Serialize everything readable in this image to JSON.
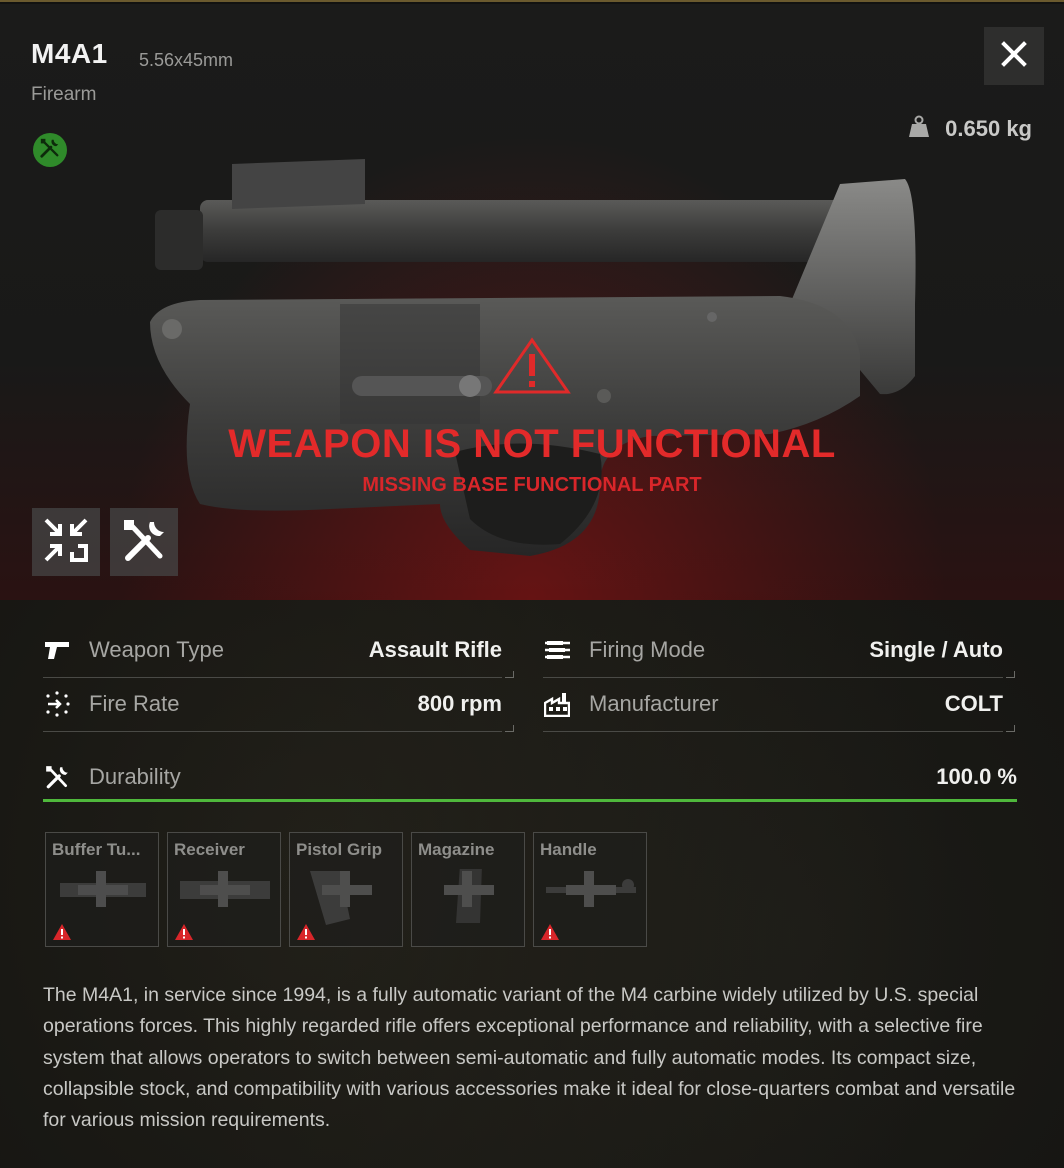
{
  "item": {
    "name": "M4A1",
    "caliber": "5.56x45mm",
    "category": "Firearm",
    "weight": "0.650 kg"
  },
  "status": {
    "title": "WEAPON IS NOT FUNCTIONAL",
    "subtitle": "MISSING BASE FUNCTIONAL PART"
  },
  "stats": {
    "weapon_type_label": "Weapon Type",
    "weapon_type_value": "Assault Rifle",
    "fire_rate_label": "Fire Rate",
    "fire_rate_value": "800 rpm",
    "firing_mode_label": "Firing Mode",
    "firing_mode_value": "Single / Auto",
    "manufacturer_label": "Manufacturer",
    "manufacturer_value": "COLT",
    "durability_label": "Durability",
    "durability_value": "100.0 %",
    "durability_fraction": 1.0
  },
  "slots": [
    {
      "name": "Buffer Tu...",
      "missing": true
    },
    {
      "name": "Receiver",
      "missing": true
    },
    {
      "name": "Pistol Grip",
      "missing": true
    },
    {
      "name": "Magazine",
      "missing": false
    },
    {
      "name": "Handle",
      "missing": true
    }
  ],
  "description": "The M4A1, in service since 1994, is a fully automatic variant of the M4 carbine widely utilized by U.S. special operations forces. This highly regarded rifle offers exceptional performance and reliability, with a selective fire system that allows operators to switch between semi-automatic and fully automatic modes. Its compact size, collapsible stock, and compatibility with various accessories make it ideal for close-quarters combat and versatile for various mission requirements.",
  "colors": {
    "warning_red": "#e32a2a",
    "durability_green": "#4fb83c",
    "repair_badge_green": "#2f8a2a"
  },
  "icons": {
    "close": "close-icon",
    "weight": "weight-icon",
    "repair_badge": "wrench-screwdriver-icon",
    "collapse": "collapse-arrows-icon",
    "tools": "tools-icon",
    "weapon_type": "pistol-icon",
    "fire_rate": "fire-rate-icon",
    "firing_mode": "bullets-icon",
    "manufacturer": "factory-icon",
    "durability": "wrench-screwdriver-icon",
    "slot_alert": "warning-triangle-icon"
  }
}
